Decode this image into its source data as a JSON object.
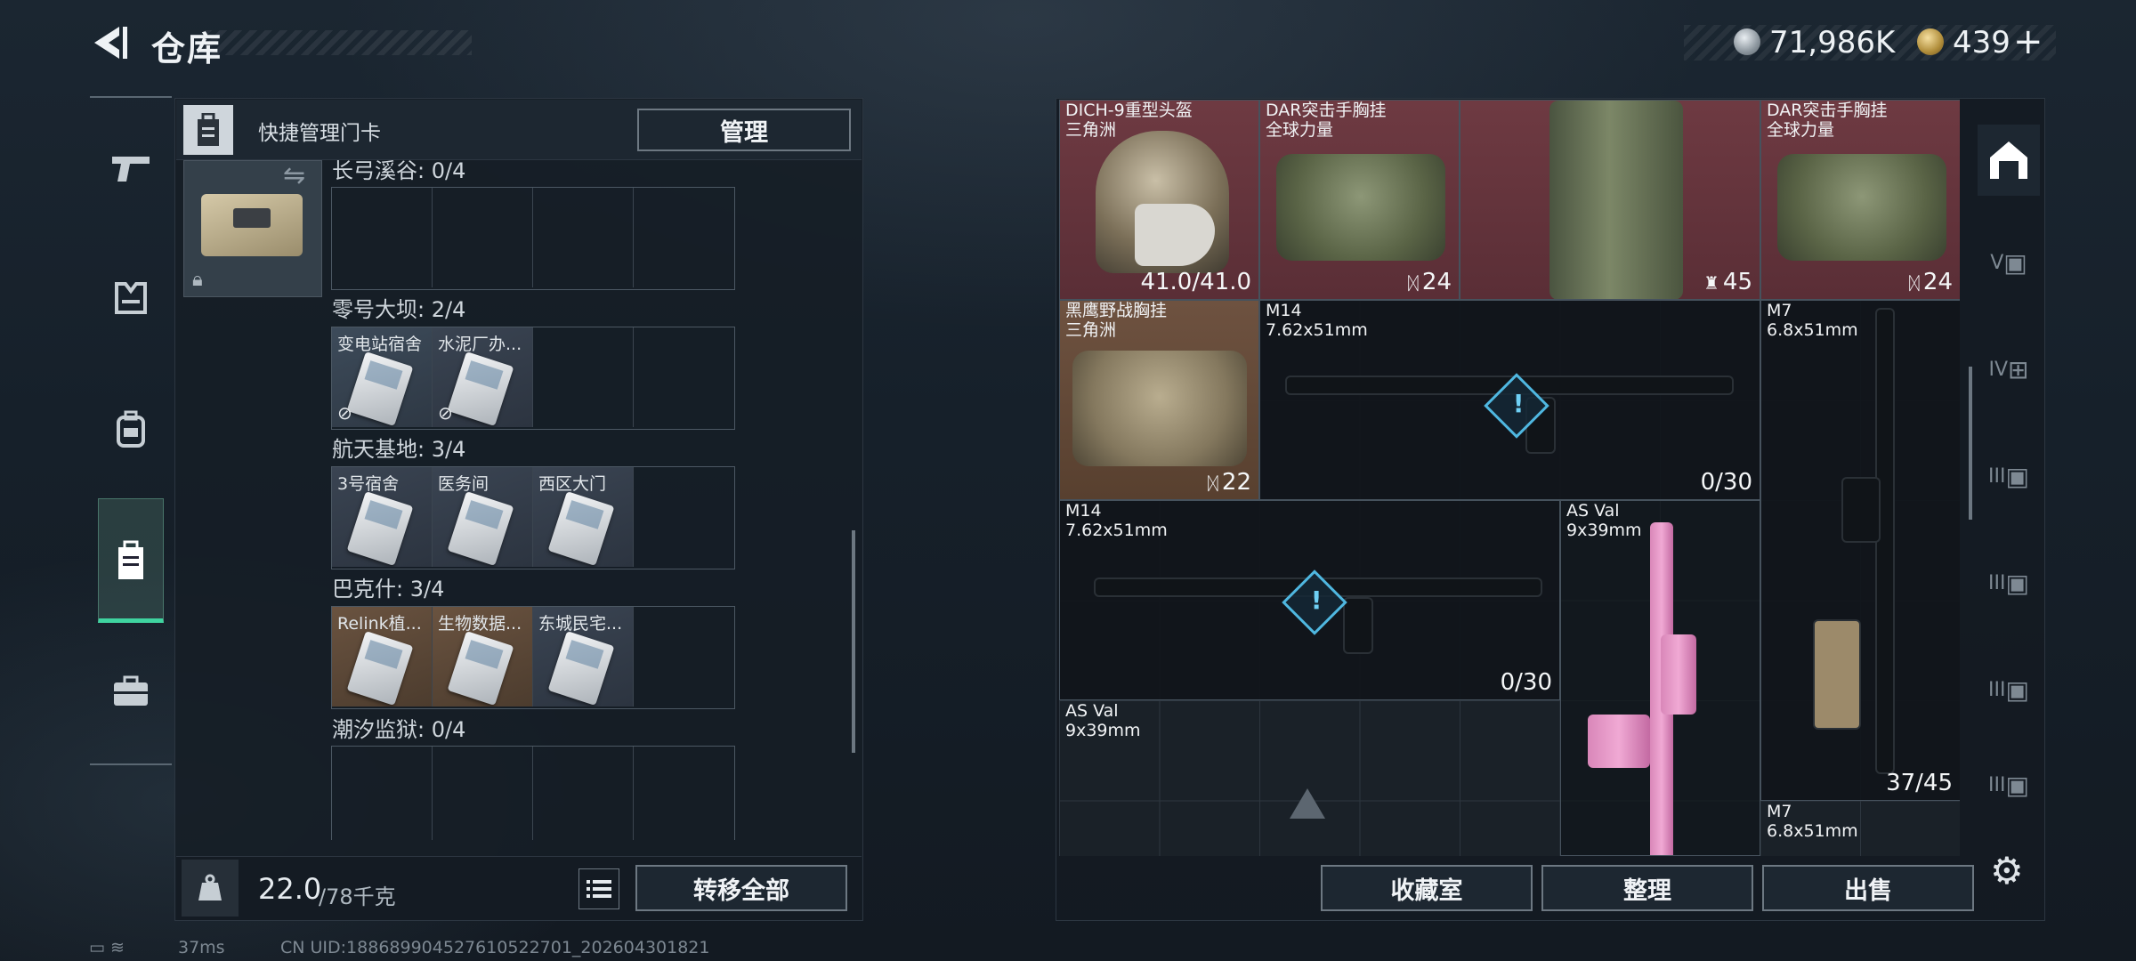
{
  "header": {
    "title": "仓库"
  },
  "currency": {
    "coins": "71,986K",
    "tickets": "439",
    "plus": "+"
  },
  "quick_card": {
    "title": "快捷管理门卡",
    "manage_label": "管理",
    "swap_icon": "swap-icon",
    "lock_icon": "lock-icon"
  },
  "regions": [
    {
      "label": "长弓溪谷: 0/4",
      "slots": []
    },
    {
      "label": "零号大坝: 2/4",
      "slots": [
        "变电站宿舍",
        "水泥厂办..."
      ]
    },
    {
      "label": "航天基地: 3/4",
      "slots": [
        "3号宿舍",
        "医务间",
        "西区大门"
      ]
    },
    {
      "label": "巴克什: 3/4",
      "slots": [
        "Relink植...",
        "生物数据...",
        "东城民宅..."
      ]
    },
    {
      "label": "潮汐监狱: 0/4",
      "slots": []
    }
  ],
  "footer": {
    "weight": "22.0",
    "weight_max": "/78千克",
    "transfer_all": "转移全部"
  },
  "status": {
    "ping": "37ms",
    "uid": "CN UID:188689904527610522701_202604301821"
  },
  "items": {
    "helmet": {
      "name": "DICH-9重型头盔",
      "sub": "三角洲",
      "value": "41.0/41.0"
    },
    "vest1": {
      "name": "DAR突击手胸挂",
      "sub": "全球力量",
      "value": "24"
    },
    "backpack": {
      "value": "45"
    },
    "vest2": {
      "name": "DAR突击手胸挂",
      "sub": "全球力量",
      "value": "24"
    },
    "vest3": {
      "name": "黑鹰野战胸挂",
      "sub": "三角洲",
      "value": "22"
    },
    "m14a": {
      "name": "M14",
      "sub": "7.62x51mm",
      "value": "0/30"
    },
    "m7a": {
      "name": "M7",
      "sub": "6.8x51mm",
      "value": "37/45"
    },
    "m14b": {
      "name": "M14",
      "sub": "7.62x51mm",
      "value": "0/30"
    },
    "asval_a": {
      "name": "AS Val",
      "sub": "9x39mm"
    },
    "asval_b": {
      "name": "AS Val",
      "sub": "9x39mm"
    },
    "m7b": {
      "name": "M7",
      "sub": "6.8x51mm"
    }
  },
  "right_buttons": {
    "collection": "收藏室",
    "organize": "整理",
    "sell": "出售"
  },
  "side_tabs": [
    "V",
    "IV",
    "III",
    "III",
    "III",
    "III"
  ]
}
